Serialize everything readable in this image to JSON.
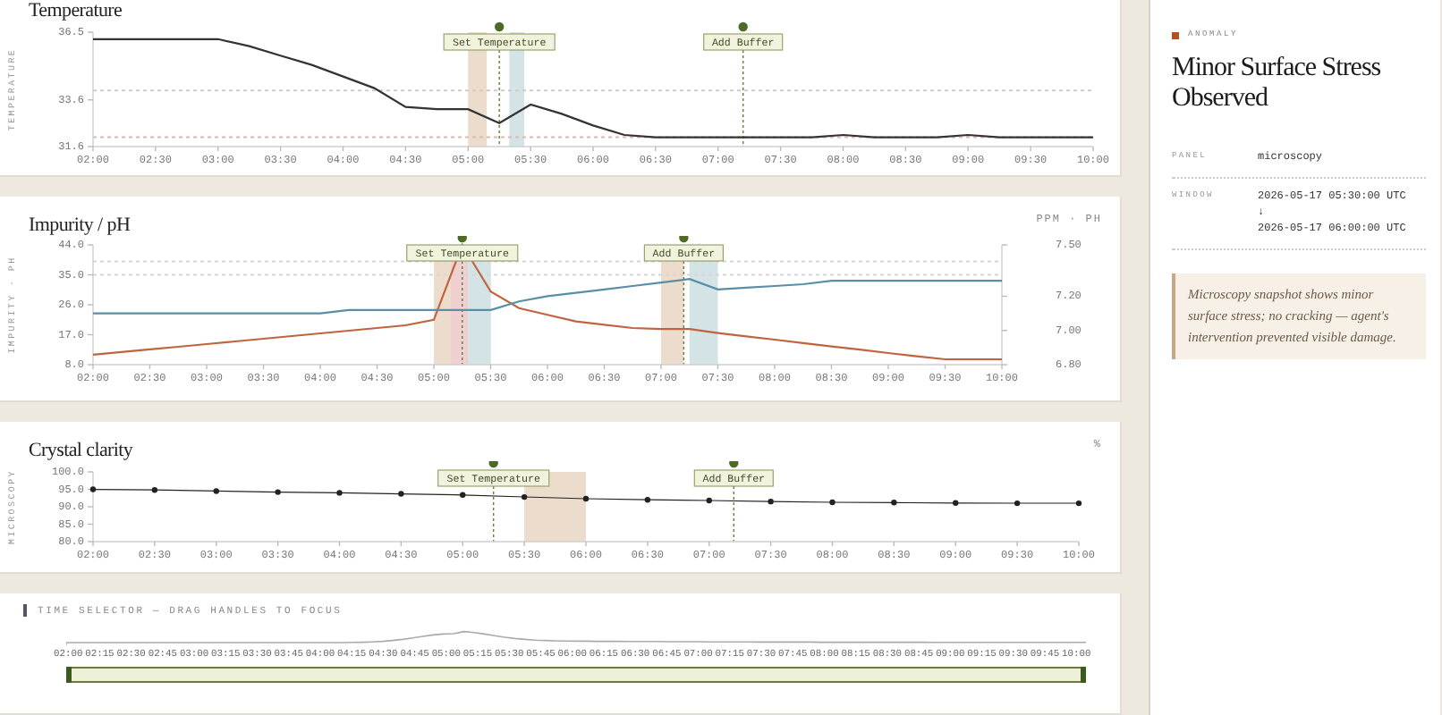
{
  "charts": [
    {
      "title": "Temperature",
      "chart_data": {
        "type": "line",
        "ylabel": "TEMPERATURE",
        "x": [
          2,
          2.25,
          2.5,
          2.75,
          3,
          3.25,
          3.5,
          3.75,
          4,
          4.25,
          4.5,
          4.75,
          5,
          5.25,
          5.5,
          5.75,
          6,
          6.25,
          6.5,
          6.75,
          7,
          7.25,
          7.5,
          7.75,
          8,
          8.25,
          8.5,
          8.75,
          9,
          9.25,
          9.5,
          9.75,
          10
        ],
        "xlim": [
          2,
          10
        ],
        "ylim": [
          31.6,
          36.5
        ],
        "xticks": [
          {
            "value": 2,
            "label": "02:00"
          },
          {
            "value": 2.5,
            "label": "02:30"
          },
          {
            "value": 3,
            "label": "03:00"
          },
          {
            "value": 3.5,
            "label": "03:30"
          },
          {
            "value": 4,
            "label": "04:00"
          },
          {
            "value": 4.5,
            "label": "04:30"
          },
          {
            "value": 5,
            "label": "05:00"
          },
          {
            "value": 5.5,
            "label": "05:30"
          },
          {
            "value": 6,
            "label": "06:00"
          },
          {
            "value": 6.5,
            "label": "06:30"
          },
          {
            "value": 7,
            "label": "07:00"
          },
          {
            "value": 7.5,
            "label": "07:30"
          },
          {
            "value": 8,
            "label": "08:00"
          },
          {
            "value": 8.5,
            "label": "08:30"
          },
          {
            "value": 9,
            "label": "09:00"
          },
          {
            "value": 9.5,
            "label": "09:30"
          },
          {
            "value": 10,
            "label": "10:00"
          }
        ],
        "yticks": [
          {
            "value": 31.6,
            "label": "31.6"
          },
          {
            "value": 33.6,
            "label": "33.6"
          },
          {
            "value": 36.5,
            "label": "36.5"
          }
        ],
        "series": [
          {
            "color": "#333333",
            "values": [
              36.2,
              36.2,
              36.2,
              36.2,
              36.2,
              35.9,
              35.5,
              35.1,
              34.6,
              34.1,
              33.3,
              33.2,
              33.2,
              32.6,
              33.4,
              33.0,
              32.5,
              32.1,
              32.0,
              32.0,
              32.0,
              32.0,
              32.0,
              32.0,
              32.1,
              32.0,
              32.0,
              32.0,
              32.1,
              32.0,
              32.0,
              32.0,
              32.0
            ]
          }
        ],
        "annotations": [
          "Set Temperature",
          "Add Buffer"
        ]
      }
    },
    {
      "title": "Impurity / pH",
      "unit": "PPM · PH",
      "chart_data": {
        "type": "line",
        "ylabel": "IMPURITY · PH",
        "x": [
          2,
          2.25,
          2.5,
          2.75,
          3,
          3.25,
          3.5,
          3.75,
          4,
          4.25,
          4.5,
          4.75,
          5,
          5.25,
          5.5,
          5.75,
          6,
          6.25,
          6.5,
          6.75,
          7,
          7.25,
          7.5,
          7.75,
          8,
          8.25,
          8.5,
          8.75,
          9,
          9.25,
          9.5,
          9.75,
          10
        ],
        "xlim": [
          2,
          10
        ],
        "ylim": [
          8,
          44
        ],
        "y2lim": [
          6.8,
          7.5
        ],
        "xticks": [
          {
            "value": 2,
            "label": "02:00"
          },
          {
            "value": 2.5,
            "label": "02:30"
          },
          {
            "value": 3,
            "label": "03:00"
          },
          {
            "value": 3.5,
            "label": "03:30"
          },
          {
            "value": 4,
            "label": "04:00"
          },
          {
            "value": 4.5,
            "label": "04:30"
          },
          {
            "value": 5,
            "label": "05:00"
          },
          {
            "value": 5.5,
            "label": "05:30"
          },
          {
            "value": 6,
            "label": "06:00"
          },
          {
            "value": 6.5,
            "label": "06:30"
          },
          {
            "value": 7,
            "label": "07:00"
          },
          {
            "value": 7.5,
            "label": "07:30"
          },
          {
            "value": 8,
            "label": "08:00"
          },
          {
            "value": 8.5,
            "label": "08:30"
          },
          {
            "value": 9,
            "label": "09:00"
          },
          {
            "value": 9.5,
            "label": "09:30"
          },
          {
            "value": 10,
            "label": "10:00"
          }
        ],
        "yticks": [
          {
            "value": 8,
            "label": "8.0"
          },
          {
            "value": 17,
            "label": "17.0"
          },
          {
            "value": 26,
            "label": "26.0"
          },
          {
            "value": 35,
            "label": "35.0"
          },
          {
            "value": 44,
            "label": "44.0"
          }
        ],
        "y2ticks": [
          {
            "value": 6.8,
            "label": "6.80"
          },
          {
            "value": 7.0,
            "label": "7.00"
          },
          {
            "value": 7.2,
            "label": "7.20"
          },
          {
            "value": 7.5,
            "label": "7.50"
          }
        ],
        "series": [
          {
            "color": "#c0643f",
            "values": [
              11,
              11.8,
              12.6,
              13.4,
              14.2,
              15,
              15.8,
              16.6,
              17.4,
              18.2,
              19,
              19.8,
              21.5,
              44,
              30,
              25,
              23,
              21,
              20,
              19,
              18.7,
              18.7,
              17.5,
              16.5,
              15.5,
              14.5,
              13.5,
              12.5,
              11.5,
              10.5,
              9.6,
              9.6,
              9.6
            ]
          },
          {
            "color": "#5a8ea6",
            "axis": "y2",
            "values": [
              7.1,
              7.1,
              7.1,
              7.1,
              7.1,
              7.1,
              7.1,
              7.1,
              7.1,
              7.12,
              7.12,
              7.12,
              7.12,
              7.12,
              7.12,
              7.17,
              7.2,
              7.22,
              7.24,
              7.26,
              7.28,
              7.3,
              7.24,
              7.25,
              7.26,
              7.27,
              7.29,
              7.29,
              7.29,
              7.29,
              7.29,
              7.29,
              7.29
            ]
          }
        ],
        "annotations": [
          "Set Temperature",
          "Add Buffer"
        ]
      }
    },
    {
      "title": "Crystal clarity",
      "unit": "%",
      "chart_data": {
        "type": "line",
        "ylabel": "MICROSCOPY",
        "x": [
          2,
          2.5,
          3,
          3.5,
          4,
          4.5,
          5,
          5.5,
          6,
          6.5,
          7,
          7.5,
          8,
          8.5,
          9,
          9.5,
          10
        ],
        "xlim": [
          2,
          10
        ],
        "ylim": [
          80,
          100
        ],
        "xticks": [
          {
            "value": 2,
            "label": "02:00"
          },
          {
            "value": 2.5,
            "label": "02:30"
          },
          {
            "value": 3,
            "label": "03:00"
          },
          {
            "value": 3.5,
            "label": "03:30"
          },
          {
            "value": 4,
            "label": "04:00"
          },
          {
            "value": 4.5,
            "label": "04:30"
          },
          {
            "value": 5,
            "label": "05:00"
          },
          {
            "value": 5.5,
            "label": "05:30"
          },
          {
            "value": 6,
            "label": "06:00"
          },
          {
            "value": 6.5,
            "label": "06:30"
          },
          {
            "value": 7,
            "label": "07:00"
          },
          {
            "value": 7.5,
            "label": "07:30"
          },
          {
            "value": 8,
            "label": "08:00"
          },
          {
            "value": 8.5,
            "label": "08:30"
          },
          {
            "value": 9,
            "label": "09:00"
          },
          {
            "value": 9.5,
            "label": "09:30"
          },
          {
            "value": 10,
            "label": "10:00"
          }
        ],
        "yticks": [
          {
            "value": 80,
            "label": "80.0"
          },
          {
            "value": 85,
            "label": "85.0"
          },
          {
            "value": 90,
            "label": "90.0"
          },
          {
            "value": 95,
            "label": "95.0"
          },
          {
            "value": 100,
            "label": "100.0"
          }
        ],
        "series": [
          {
            "color": "#222222",
            "marker": "o",
            "values": [
              95.0,
              94.8,
              94.5,
              94.2,
              94.0,
              93.7,
              93.4,
              92.8,
              92.3,
              92.0,
              91.8,
              91.5,
              91.3,
              91.2,
              91.1,
              91.0,
              91.0
            ]
          }
        ],
        "annotations": [
          "Set Temperature",
          "Add Buffer"
        ]
      }
    }
  ],
  "time_selector": {
    "label": "TIME SELECTOR — DRAG HANDLES TO FOCUS",
    "level": 1,
    "ticks": [
      "02:00",
      "02:15",
      "02:30",
      "02:45",
      "03:00",
      "03:15",
      "03:30",
      "03:45",
      "04:00",
      "04:15",
      "04:30",
      "04:45",
      "05:00",
      "05:15",
      "05:30",
      "05:45",
      "06:00",
      "06:15",
      "06:30",
      "06:45",
      "07:00",
      "07:15",
      "07:30",
      "07:45",
      "08:00",
      "08:15",
      "08:30",
      "08:45",
      "09:00",
      "09:15",
      "09:30",
      "09:45",
      "10:00"
    ]
  },
  "detail": {
    "tag": "ANOMALY",
    "title": "Minor Surface Stress Observed",
    "rows": [
      {
        "label": "PANEL",
        "lines": [
          "microscopy"
        ]
      },
      {
        "label": "WINDOW",
        "lines": [
          "2026-05-17 05:30:00 UTC",
          "↓",
          "2026-05-17 06:00:00 UTC"
        ]
      }
    ],
    "note": "Microscopy snapshot shows minor surface stress; no cracking — agent's intervention prevented visible damage."
  }
}
